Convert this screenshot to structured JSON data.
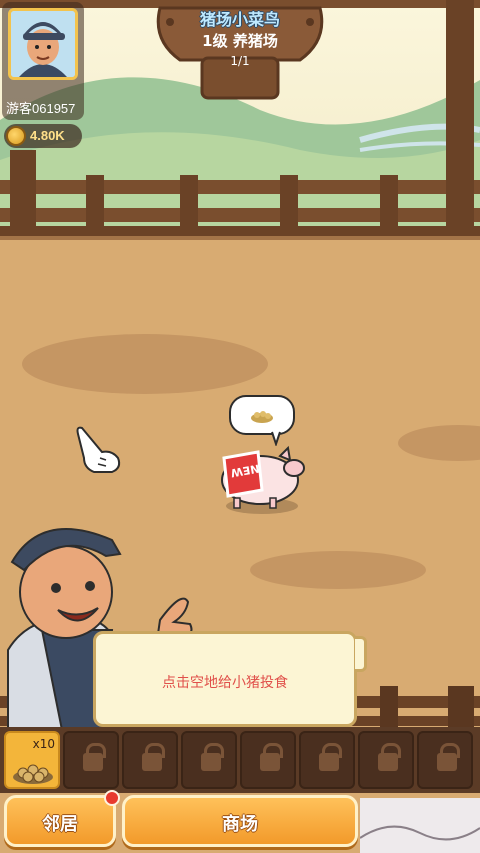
{
  "player": {
    "name": "游客061957",
    "coins": "4.80K"
  },
  "farm_sign": {
    "title": "猪场小菜鸟",
    "level": "1级 养猪场",
    "progress": "1/1"
  },
  "pig": {
    "tag": "NEW"
  },
  "tutorial": {
    "message": "点击空地给小猪投食"
  },
  "inventory": {
    "feed_count": "x10",
    "slots_total": 8,
    "locked_slots": 7
  },
  "buttons": {
    "neighbors": "邻居",
    "shop": "商场"
  },
  "colors": {
    "accent": "#f29a2a",
    "dialog_text": "#e0504a"
  }
}
